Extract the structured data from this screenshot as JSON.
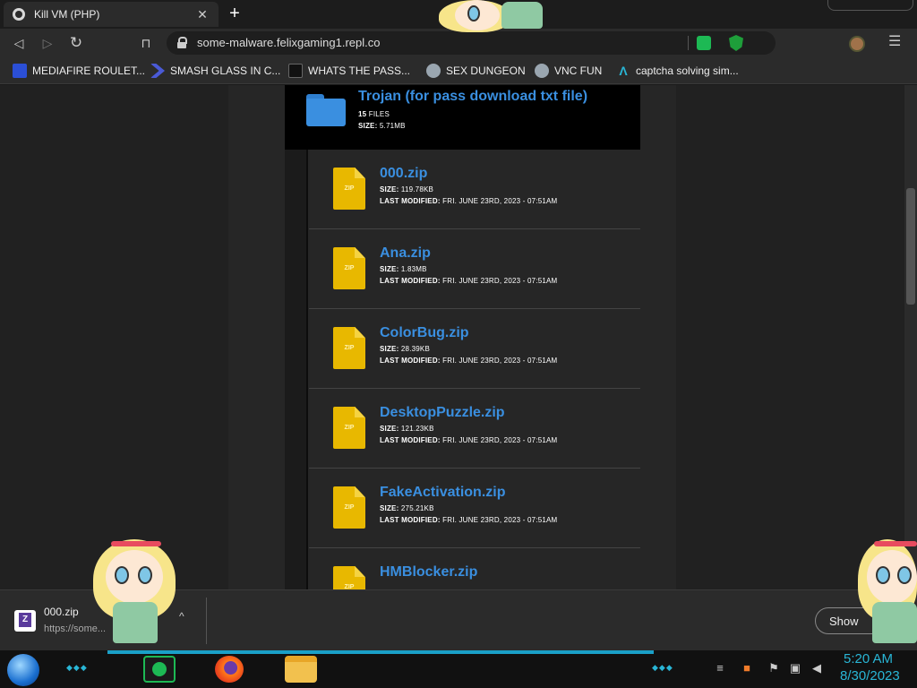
{
  "browser": {
    "tab_title": "Kill VM (PHP)",
    "tab_close": "✕",
    "new_tab": "+",
    "url": "some-malware.felixgaming1.repl.co",
    "nav": {
      "back": "◁",
      "forward": "▷",
      "reload": "↻",
      "bookmark": "⊓",
      "menu": "☰"
    },
    "bookmarks": [
      {
        "label": "MEDIAFIRE ROULET...",
        "icon": "mf-icon",
        "color": "#2b4fd6"
      },
      {
        "label": "SMASH GLASS IN C...",
        "icon": "chevron-icon",
        "color": "#4a5ad6"
      },
      {
        "label": "WHATS THE PASS...",
        "icon": "mask-icon",
        "color": "#111111"
      },
      {
        "label": "SEX DUNGEON",
        "icon": "robot-icon",
        "color": "#9aa6b0"
      },
      {
        "label": "VNC FUN",
        "icon": "robot-icon",
        "color": "#9aa6b0"
      },
      {
        "label": "captcha solving sim...",
        "icon": "a-icon",
        "color": "#29b6d6"
      }
    ]
  },
  "folder": {
    "title": "Trojan (for pass download txt file)",
    "files_count": "15",
    "files_label": "FILES",
    "size_label": "SIZE:",
    "size": "5.71MB"
  },
  "files": [
    {
      "name": "000.zip",
      "size": "119.78KB",
      "modified": "FRI. JUNE 23RD, 2023 - 07:51AM"
    },
    {
      "name": "Ana.zip",
      "size": "1.83MB",
      "modified": "FRI. JUNE 23RD, 2023 - 07:51AM"
    },
    {
      "name": "ColorBug.zip",
      "size": "28.39KB",
      "modified": "FRI. JUNE 23RD, 2023 - 07:51AM"
    },
    {
      "name": "DesktopPuzzle.zip",
      "size": "121.23KB",
      "modified": "FRI. JUNE 23RD, 2023 - 07:51AM"
    },
    {
      "name": "FakeActivation.zip",
      "size": "275.21KB",
      "modified": "FRI. JUNE 23RD, 2023 - 07:51AM"
    },
    {
      "name": "HMBlocker.zip",
      "size": "",
      "modified": ""
    }
  ],
  "labels": {
    "size": "SIZE:",
    "modified": "LAST MODIFIED:",
    "zip": "ZIP"
  },
  "download": {
    "filename": "000.zip",
    "url": "https://some...",
    "chevron": "^",
    "show_all": "Show"
  },
  "taskbar": {
    "time": "5:20 AM",
    "date": "8/30/2023"
  },
  "colors": {
    "link_blue": "#3a8fe0",
    "zip_yellow": "#e8b800",
    "clock_cyan": "#29b6d6"
  }
}
